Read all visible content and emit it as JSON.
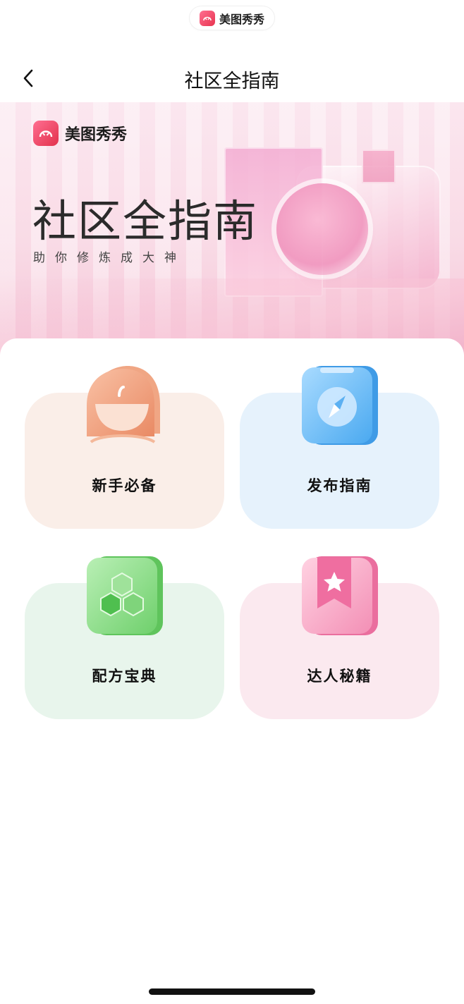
{
  "status": {
    "app_name": "美图秀秀"
  },
  "navbar": {
    "title": "社区全指南"
  },
  "banner": {
    "brand": "美图秀秀",
    "title": "社区全指南",
    "subtitle": "助你修炼成大神"
  },
  "cards": [
    {
      "label": "新手必备",
      "icon": "person-bust-icon",
      "color": "#faeee8"
    },
    {
      "label": "发布指南",
      "icon": "compass-phone-icon",
      "color": "#e6f2fc"
    },
    {
      "label": "配方宝典",
      "icon": "hexagon-cluster-icon",
      "color": "#e8f5ec"
    },
    {
      "label": "达人秘籍",
      "icon": "star-bookmark-book-icon",
      "color": "#fbe9ef"
    }
  ],
  "colors": {
    "brand": "#e8344f"
  }
}
